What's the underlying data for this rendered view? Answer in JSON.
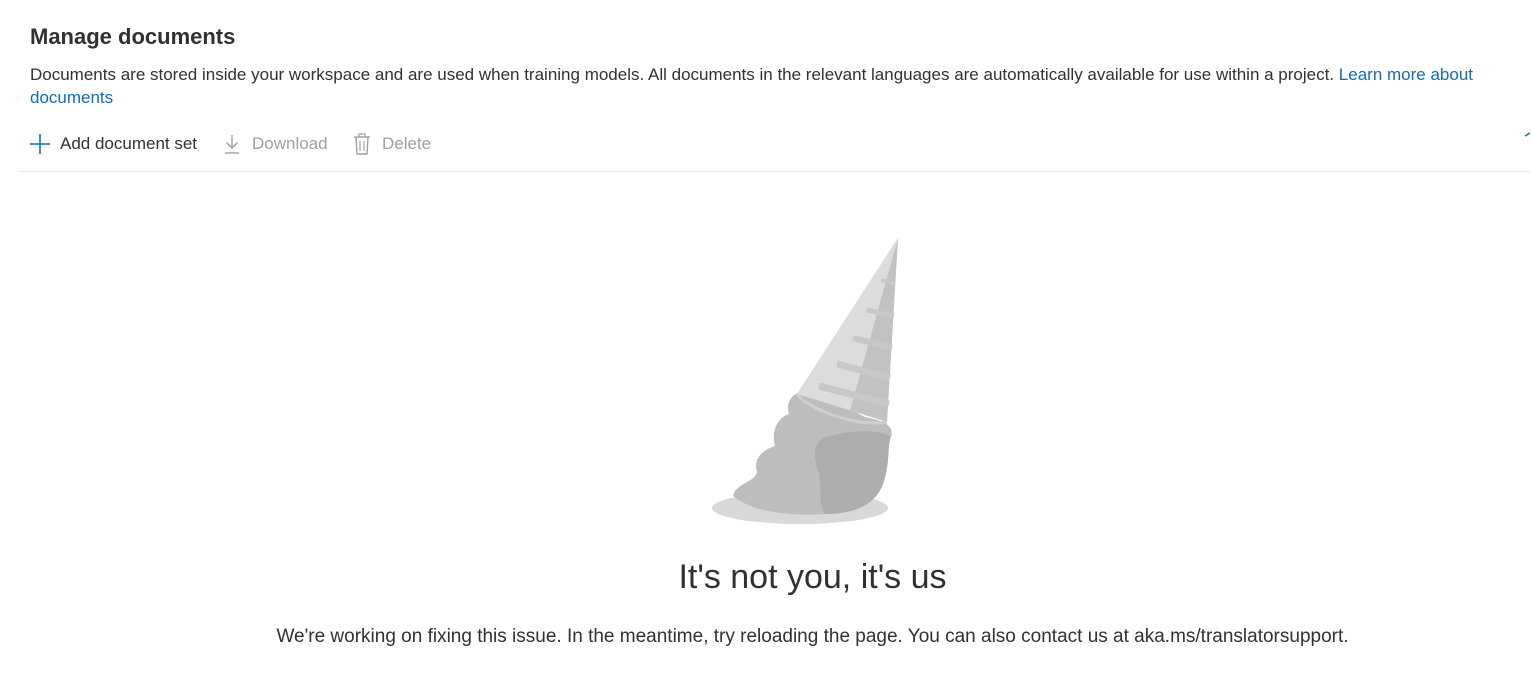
{
  "header": {
    "title": "Manage documents",
    "description": "Documents are stored inside your workspace and are used when training models. All documents in the relevant languages are automatically available for use within a project.",
    "learn_more_link": "Learn more about documents"
  },
  "toolbar": {
    "add_label": "Add document set",
    "download_label": "Download",
    "delete_label": "Delete"
  },
  "error": {
    "illustration": "dropped-ice-cream-cone",
    "heading": "It's not you, it's us",
    "message": "We're working on fixing this issue. In the meantime, try reloading the page. You can also contact us at aka.ms/translatorsupport."
  },
  "colors": {
    "link": "#0f6cbd",
    "disabled": "#a19f9d",
    "text": "#323130"
  }
}
